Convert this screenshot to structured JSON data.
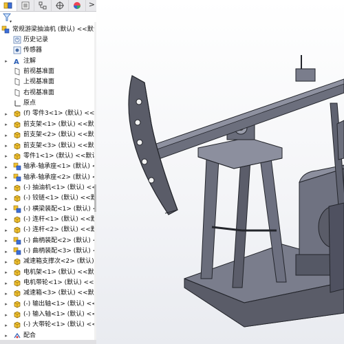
{
  "tabs": [
    {
      "icon": "feature-manager-icon",
      "active": true
    },
    {
      "icon": "property-manager-icon",
      "active": false
    },
    {
      "icon": "configuration-manager-icon",
      "active": false
    },
    {
      "icon": "dimxpert-manager-icon",
      "active": false
    },
    {
      "icon": "display-manager-icon",
      "active": false
    }
  ],
  "tab_overflow": ">",
  "tree": {
    "root": {
      "label": "常规游梁抽油机 (默认) <<默认",
      "icon": "assembly-icon"
    },
    "items": [
      {
        "label": "历史记录",
        "icon": "history-icon",
        "arrow": ""
      },
      {
        "label": "传感器",
        "icon": "sensor-icon",
        "arrow": ""
      },
      {
        "label": "注解",
        "icon": "annotation-icon",
        "arrow": "▸"
      },
      {
        "label": "前视基准面",
        "icon": "plane-icon",
        "arrow": ""
      },
      {
        "label": "上视基准面",
        "icon": "plane-icon",
        "arrow": ""
      },
      {
        "label": "右视基准面",
        "icon": "plane-icon",
        "arrow": ""
      },
      {
        "label": "原点",
        "icon": "origin-icon",
        "arrow": ""
      },
      {
        "label": "(f) 零件3<1> (默认) <<默认",
        "icon": "part-icon",
        "arrow": "▸"
      },
      {
        "label": "前支架<1> (默认) <<默认>",
        "icon": "part-icon",
        "arrow": "▸"
      },
      {
        "label": "前支架<2> (默认) <<默认>",
        "icon": "part-icon",
        "arrow": "▸"
      },
      {
        "label": "前支架<3> (默认) <<默认>",
        "icon": "part-icon",
        "arrow": "▸"
      },
      {
        "label": "零件1<1> (默认) <<默认>",
        "icon": "part-icon",
        "arrow": "▸"
      },
      {
        "label": "轴承-轴承座<1> (默认) <<",
        "icon": "subassembly-icon",
        "arrow": "▸"
      },
      {
        "label": "轴承-轴承座<2> (默认) <<",
        "icon": "subassembly-icon",
        "arrow": "▸"
      },
      {
        "label": "(-) 抽油机<1> (默认) <<默",
        "icon": "part-icon",
        "arrow": "▸"
      },
      {
        "label": "(-) 铰链<1> (默认) <<默认",
        "icon": "part-icon",
        "arrow": "▸"
      },
      {
        "label": "(-) 横梁装配<1> (默认) <<",
        "icon": "subassembly-icon",
        "arrow": "▸"
      },
      {
        "label": "(-) 连杆<1> (默认) <<默认",
        "icon": "part-icon",
        "arrow": "▸"
      },
      {
        "label": "(-) 连杆<2> (默认) <<默认",
        "icon": "part-icon",
        "arrow": "▸"
      },
      {
        "label": "(-) 曲柄装配<2> (默认) <<",
        "icon": "subassembly-icon",
        "arrow": "▸"
      },
      {
        "label": "(-) 曲柄装配<3> (默认) <<",
        "icon": "subassembly-icon",
        "arrow": "▸"
      },
      {
        "label": "减速箱支撑次<2> (默认) <<",
        "icon": "part-icon",
        "arrow": "▸"
      },
      {
        "label": "电机架<1> (默认) <<默认>",
        "icon": "part-icon",
        "arrow": "▸"
      },
      {
        "label": "电机带轮<1> (默认) <<默",
        "icon": "part-icon",
        "arrow": "▸"
      },
      {
        "label": "减速箱<3> (默认) <<默认>",
        "icon": "part-icon",
        "arrow": "▸"
      },
      {
        "label": "(-) 输出轴<1> (默认) <<默",
        "icon": "part-icon",
        "arrow": "▸"
      },
      {
        "label": "(-) 输入轴<1> (默认) <<默",
        "icon": "part-icon",
        "arrow": "▸"
      },
      {
        "label": "(-) 大带轮<1> (默认) <<默",
        "icon": "part-icon",
        "arrow": "▸"
      },
      {
        "label": "配合",
        "icon": "mates-icon",
        "arrow": "▸"
      }
    ]
  },
  "colors": {
    "part_yellow": "#f2c230",
    "part_blue": "#3d6fd8",
    "model_gray": "#5c5f6e",
    "model_light": "#8a8d9c",
    "model_dark": "#34363f"
  }
}
